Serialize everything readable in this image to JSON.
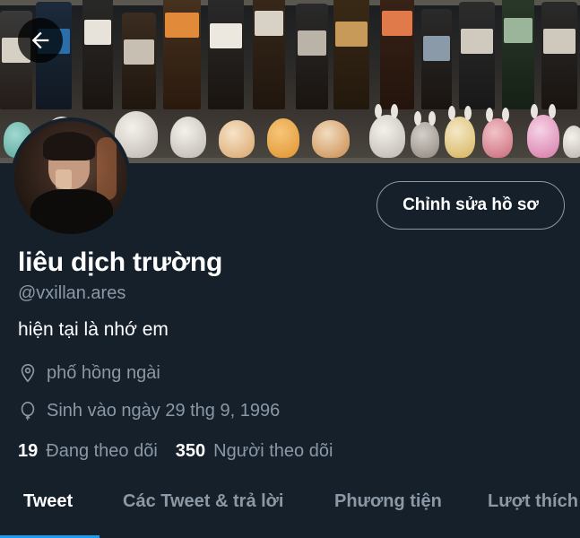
{
  "header": {
    "back_icon": "arrow-left-icon"
  },
  "profile": {
    "display_name": "liêu dịch trường",
    "handle": "@vxillan.ares",
    "bio": "hiện tại là nhớ em",
    "location": "phố hồng ngài",
    "location_icon": "location-pin-icon",
    "birthday": "Sinh vào ngày 29 thg 9, 1996",
    "birthday_icon": "balloon-icon",
    "edit_profile_label": "Chỉnh sửa hồ sơ"
  },
  "stats": {
    "following_count": "19",
    "following_label": "Đang theo dõi",
    "followers_count": "350",
    "followers_label": "Người theo dõi"
  },
  "tabs": [
    {
      "label": "Tweet",
      "active": true
    },
    {
      "label": "Các Tweet & trả lời",
      "active": false
    },
    {
      "label": "Phương tiện",
      "active": false
    },
    {
      "label": "Lượt thích",
      "active": false
    }
  ],
  "colors": {
    "background": "#15202b",
    "secondary_text": "#8b98a5",
    "accent": "#1d9bf0"
  }
}
